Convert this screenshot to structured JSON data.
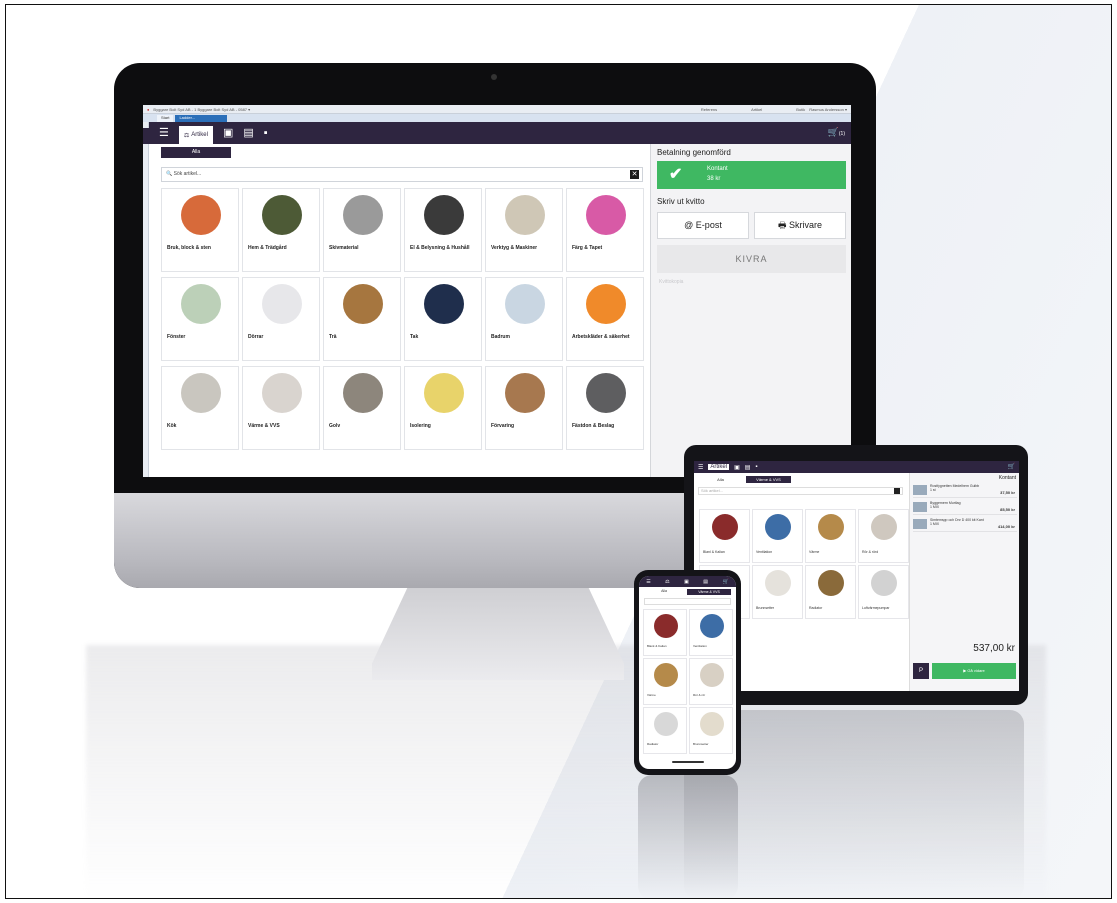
{
  "desktop": {
    "topbar": {
      "app_path": "Byggare Bolt Syd AB - 1 Byggare Bolt Syd AB - 0587 ▾",
      "search1": "Referens",
      "search2": "Artikel",
      "store": "Butik",
      "user": "Rasmus Andersson ▾"
    },
    "tabs": {
      "start": "Start",
      "active": "Ladder..."
    },
    "nav": {
      "article_label": "Artikel",
      "cart_count": "(1)"
    },
    "filter_all": "Alla",
    "search_placeholder": "Sök artikel...",
    "categories": [
      {
        "label": "Bruk, block & sten",
        "color": "#d76a3a"
      },
      {
        "label": "Hem & Trädgård",
        "color": "#4d5a36"
      },
      {
        "label": "Skivmaterial",
        "color": "#9a9a9a"
      },
      {
        "label": "El & Belysning & Hushåll",
        "color": "#3a3a3a"
      },
      {
        "label": "Verktyg & Maskiner",
        "color": "#cfc7b6"
      },
      {
        "label": "Färg & Tapet",
        "color": "#d85aa6"
      },
      {
        "label": "Fönster",
        "color": "#bcd0b8"
      },
      {
        "label": "Dörrar",
        "color": "#e7e7ea"
      },
      {
        "label": "Trä",
        "color": "#a6763f"
      },
      {
        "label": "Tak",
        "color": "#1f2e4c"
      },
      {
        "label": "Badrum",
        "color": "#c9d6e2"
      },
      {
        "label": "Arbetskläder & säkerhet",
        "color": "#f08a2a"
      },
      {
        "label": "Kök",
        "color": "#c9c6bf"
      },
      {
        "label": "Värme & VVS",
        "color": "#d9d4cf"
      },
      {
        "label": "Golv",
        "color": "#8d867c"
      },
      {
        "label": "Isolering",
        "color": "#e8d36a"
      },
      {
        "label": "Förvaring",
        "color": "#a7784f"
      },
      {
        "label": "Fästdon & Beslag",
        "color": "#5e5e60"
      }
    ],
    "payment": {
      "heading": "Betalning genomförd",
      "method": "Kontant",
      "amount": "38 kr",
      "receipt_heading": "Skriv ut kvitto",
      "email_button": "@ E-post",
      "printer_button": "🖶 Skrivare",
      "klarna": "KIVRA",
      "faint_text": "Kvittokopia"
    }
  },
  "tablet": {
    "nav_label": "Artikel",
    "filter_all": "Alla",
    "filter_active": "Värme & VVS",
    "search_placeholder": "Sök artikel...",
    "tiles": [
      {
        "label": "Blanl & Kalian",
        "color": "#8a2b2b"
      },
      {
        "label": "Ventilation",
        "color": "#3d6da6"
      },
      {
        "label": "Värme",
        "color": "#b58a4a"
      },
      {
        "label": "Rör & rörd",
        "color": "#cfc8bf"
      },
      {
        "label": "",
        "color": "#dddddd"
      },
      {
        "label": "Brunnsetter",
        "color": "#e5e2dc"
      },
      {
        "label": "Radiator",
        "color": "#8a6a3a"
      },
      {
        "label": "Luftvärmepumpar",
        "color": "#d2d2d2"
      }
    ],
    "cart_heading": "Kontant",
    "cart_items": [
      {
        "name": "Rostfygnetten Medelhem Gulbb",
        "qty": "1 st",
        "price": "37,50 kr"
      },
      {
        "name": "Byggemern Murtlag",
        "qty": "1 MIX",
        "price": "85,50 kr"
      },
      {
        "name": "Simtemspp och Dnr D 400 kit Kant",
        "qty": "1 MIX",
        "price": "414,00 kr"
      }
    ],
    "total": "537,00 kr",
    "pay_button": "▶ Gå vidare"
  },
  "phone": {
    "filter_all": "Alla",
    "filter_active": "Värme & VVS",
    "tiles": [
      {
        "label": "Blank & Kalian",
        "color": "#8a2b2b"
      },
      {
        "label": "Ventilation",
        "color": "#3d6da6"
      },
      {
        "label": "Värme",
        "color": "#b58a4a"
      },
      {
        "label": "Rör & rör",
        "color": "#d8d0c4"
      },
      {
        "label": "Radiator",
        "color": "#d8d8d8"
      },
      {
        "label": "Brunnsetter",
        "color": "#e3dccd"
      }
    ]
  }
}
